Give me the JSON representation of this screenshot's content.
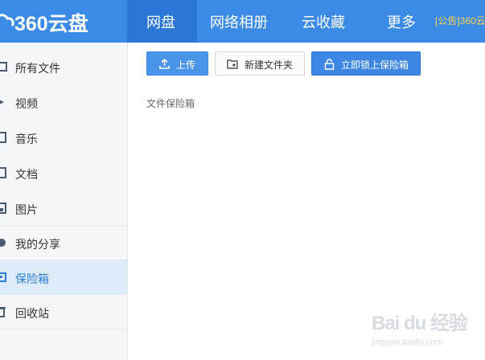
{
  "header": {
    "logo_text": "360云盘",
    "nav": [
      {
        "label": "网盘",
        "active": true
      },
      {
        "label": "网络相册",
        "active": false
      },
      {
        "label": "云收藏",
        "active": false
      },
      {
        "label": "更多",
        "active": false
      }
    ],
    "announcement": "[公告]360云"
  },
  "sidebar": {
    "items": [
      {
        "label": "所有文件",
        "icon": "folder-icon"
      },
      {
        "label": "视频",
        "icon": "video-icon"
      },
      {
        "label": "音乐",
        "icon": "music-icon"
      },
      {
        "label": "文档",
        "icon": "document-icon"
      },
      {
        "label": "图片",
        "icon": "image-icon"
      },
      {
        "label": "我的分享",
        "icon": "share-icon"
      },
      {
        "label": "保险箱",
        "icon": "safe-icon",
        "active": true
      },
      {
        "label": "回收站",
        "icon": "trash-icon"
      }
    ]
  },
  "toolbar": {
    "upload_label": "上传",
    "new_folder_label": "新建文件夹",
    "lock_safe_label": "立即锁上保险箱"
  },
  "breadcrumb": "文件保险箱",
  "watermark": {
    "mark": "Bai du 经验",
    "sub": "jingyan.baidu.com"
  },
  "colors": {
    "header_bg": "#3b8be6",
    "nav_active_bg": "#2a77d6",
    "sidebar_bg": "#f4f6f9",
    "sidebar_active_bg": "#deebf9",
    "accent": "#2d7fd6",
    "announce": "#ffd24d"
  }
}
